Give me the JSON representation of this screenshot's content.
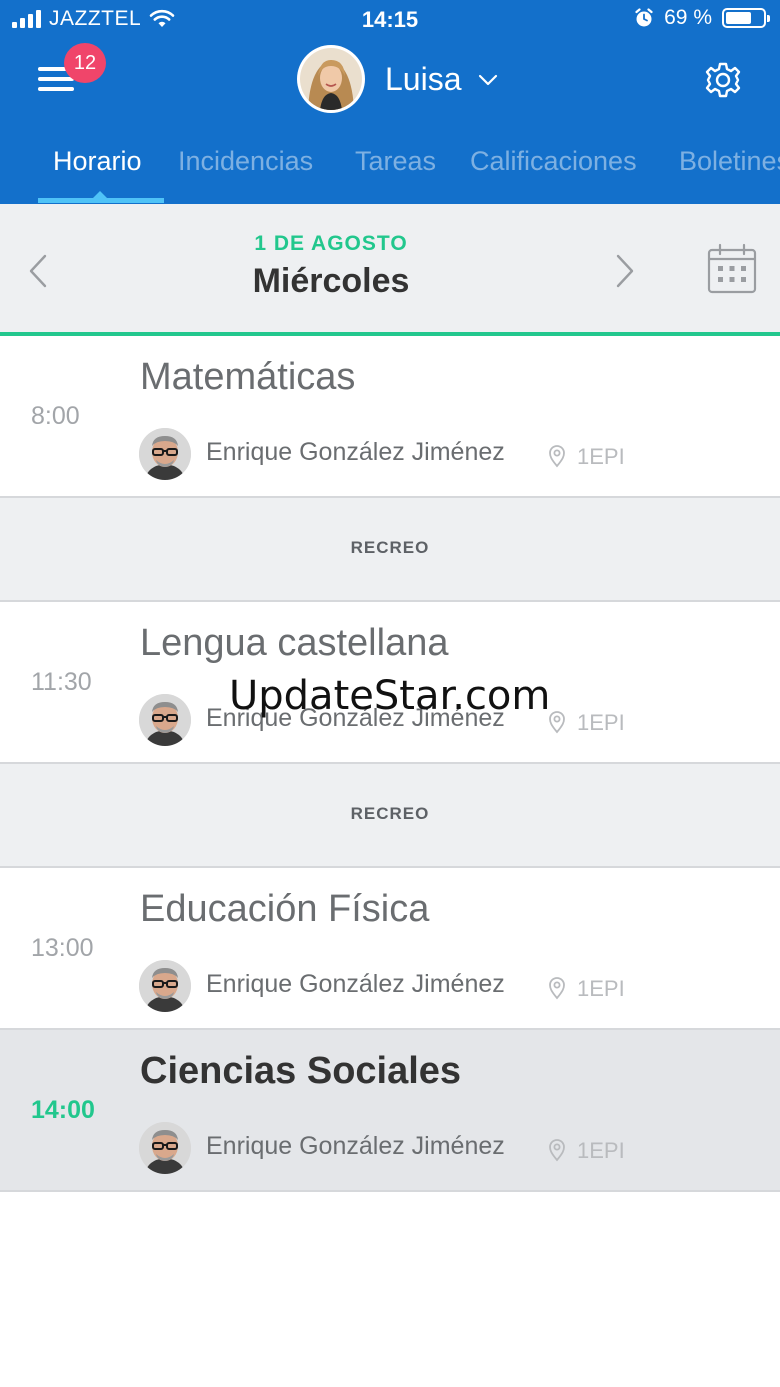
{
  "status_bar": {
    "carrier": "JAZZTEL",
    "time": "14:15",
    "battery": "69 %",
    "battery_level": 0.69
  },
  "header": {
    "badge_count": "12",
    "profile_name": "Luisa",
    "tabs": [
      {
        "label": "Horario",
        "active": true
      },
      {
        "label": "Incidencias"
      },
      {
        "label": "Tareas"
      },
      {
        "label": "Calificaciones"
      },
      {
        "label": "Boletines"
      }
    ]
  },
  "datebar": {
    "date": "1 DE AGOSTO",
    "weekday": "Miércoles"
  },
  "schedule": [
    {
      "time": "8:00",
      "subject": "Matemáticas",
      "teacher": "Enrique González Jiménez",
      "room": "1EPI"
    },
    {
      "break_label": "RECREO"
    },
    {
      "time": "11:30",
      "subject": "Lengua castellana",
      "teacher": "Enrique González Jiménez",
      "room": "1EPI"
    },
    {
      "break_label": "RECREO"
    },
    {
      "time": "13:00",
      "subject": "Educación Física",
      "teacher": "Enrique González Jiménez",
      "room": "1EPI"
    },
    {
      "time": "14:00",
      "subject": "Ciencias Sociales",
      "teacher": "Enrique González Jiménez",
      "room": "1EPI",
      "current": true
    }
  ],
  "watermark": "UpdateStar.com",
  "colors": {
    "header_blue": "#1370cb",
    "accent_green": "#22c78d",
    "badge_pink": "#f0456a",
    "tab_indicator": "#4fc3f7"
  }
}
